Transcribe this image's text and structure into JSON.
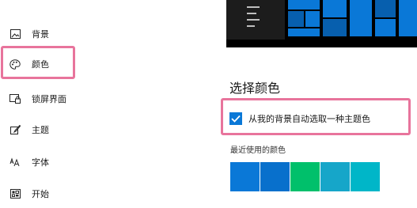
{
  "nav": {
    "items": [
      {
        "label": "背景",
        "icon": "picture-icon"
      },
      {
        "label": "颜色",
        "icon": "palette-icon"
      },
      {
        "label": "锁屏界面",
        "icon": "lock-screen-icon"
      },
      {
        "label": "主题",
        "icon": "theme-brush-icon"
      },
      {
        "label": "字体",
        "icon": "font-icon"
      },
      {
        "label": "开始",
        "icon": "start-icon"
      }
    ],
    "selected": "颜色"
  },
  "main": {
    "section_title": "选择颜色",
    "auto_color": {
      "label": "从我的背景自动选取一种主题色",
      "checked": true
    },
    "recent_colors_label": "最近使用的颜色",
    "recent_colors": [
      "#0a78d7",
      "#0870cc",
      "#00c06b",
      "#16a6c9",
      "#00b6c8"
    ]
  },
  "colors": {
    "accent": "#0a78d7",
    "highlight_box": "#e8749c",
    "preview_background": "#000000"
  }
}
